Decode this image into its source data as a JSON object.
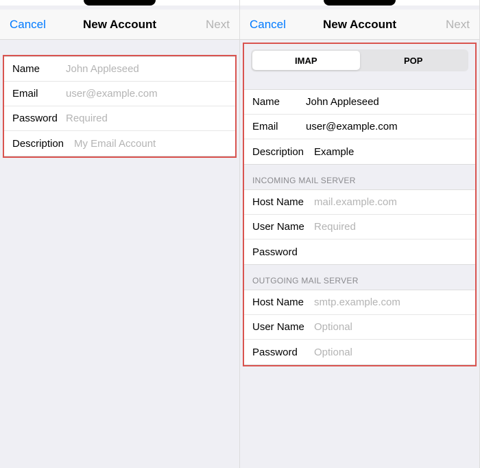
{
  "left": {
    "nav": {
      "cancel": "Cancel",
      "title": "New Account",
      "next": "Next"
    },
    "fields": {
      "name": {
        "label": "Name",
        "placeholder": "John Appleseed"
      },
      "email": {
        "label": "Email",
        "placeholder": "user@example.com"
      },
      "password": {
        "label": "Password",
        "placeholder": "Required"
      },
      "description": {
        "label": "Description",
        "placeholder": "My Email Account"
      }
    }
  },
  "right": {
    "nav": {
      "cancel": "Cancel",
      "title": "New Account",
      "next": "Next"
    },
    "tabs": {
      "imap": "IMAP",
      "pop": "POP"
    },
    "account": {
      "name": {
        "label": "Name",
        "value": "John Appleseed"
      },
      "email": {
        "label": "Email",
        "value": "user@example.com"
      },
      "description": {
        "label": "Description",
        "value": "Example"
      }
    },
    "incoming": {
      "header": "Incoming Mail Server",
      "host": {
        "label": "Host Name",
        "placeholder": "mail.example.com"
      },
      "user": {
        "label": "User Name",
        "placeholder": "Required"
      },
      "password": {
        "label": "Password",
        "placeholder": ""
      }
    },
    "outgoing": {
      "header": "Outgoing Mail Server",
      "host": {
        "label": "Host Name",
        "placeholder": "smtp.example.com"
      },
      "user": {
        "label": "User Name",
        "placeholder": "Optional"
      },
      "password": {
        "label": "Password",
        "placeholder": "Optional"
      }
    }
  }
}
